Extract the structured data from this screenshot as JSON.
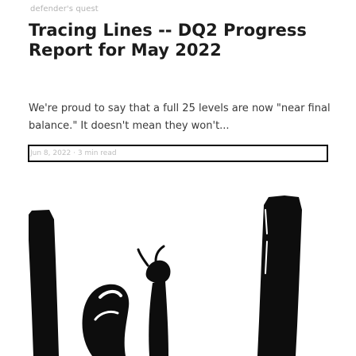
{
  "post": {
    "blog_name": "defender's quest",
    "title": "Tracing Lines -- DQ2 Progress Report for May 2022",
    "excerpt": "We're proud to say that a full 25 levels are now \"near final balance.\" It doesn't mean they won't...",
    "meta": "Jun 8, 2022 · 3 min read"
  },
  "cover": {
    "icon": "sketch-illustration",
    "colors": {
      "ink": "#0d0d0d",
      "paper": "#ffffff",
      "focus_border": "#0a0a0a"
    }
  }
}
